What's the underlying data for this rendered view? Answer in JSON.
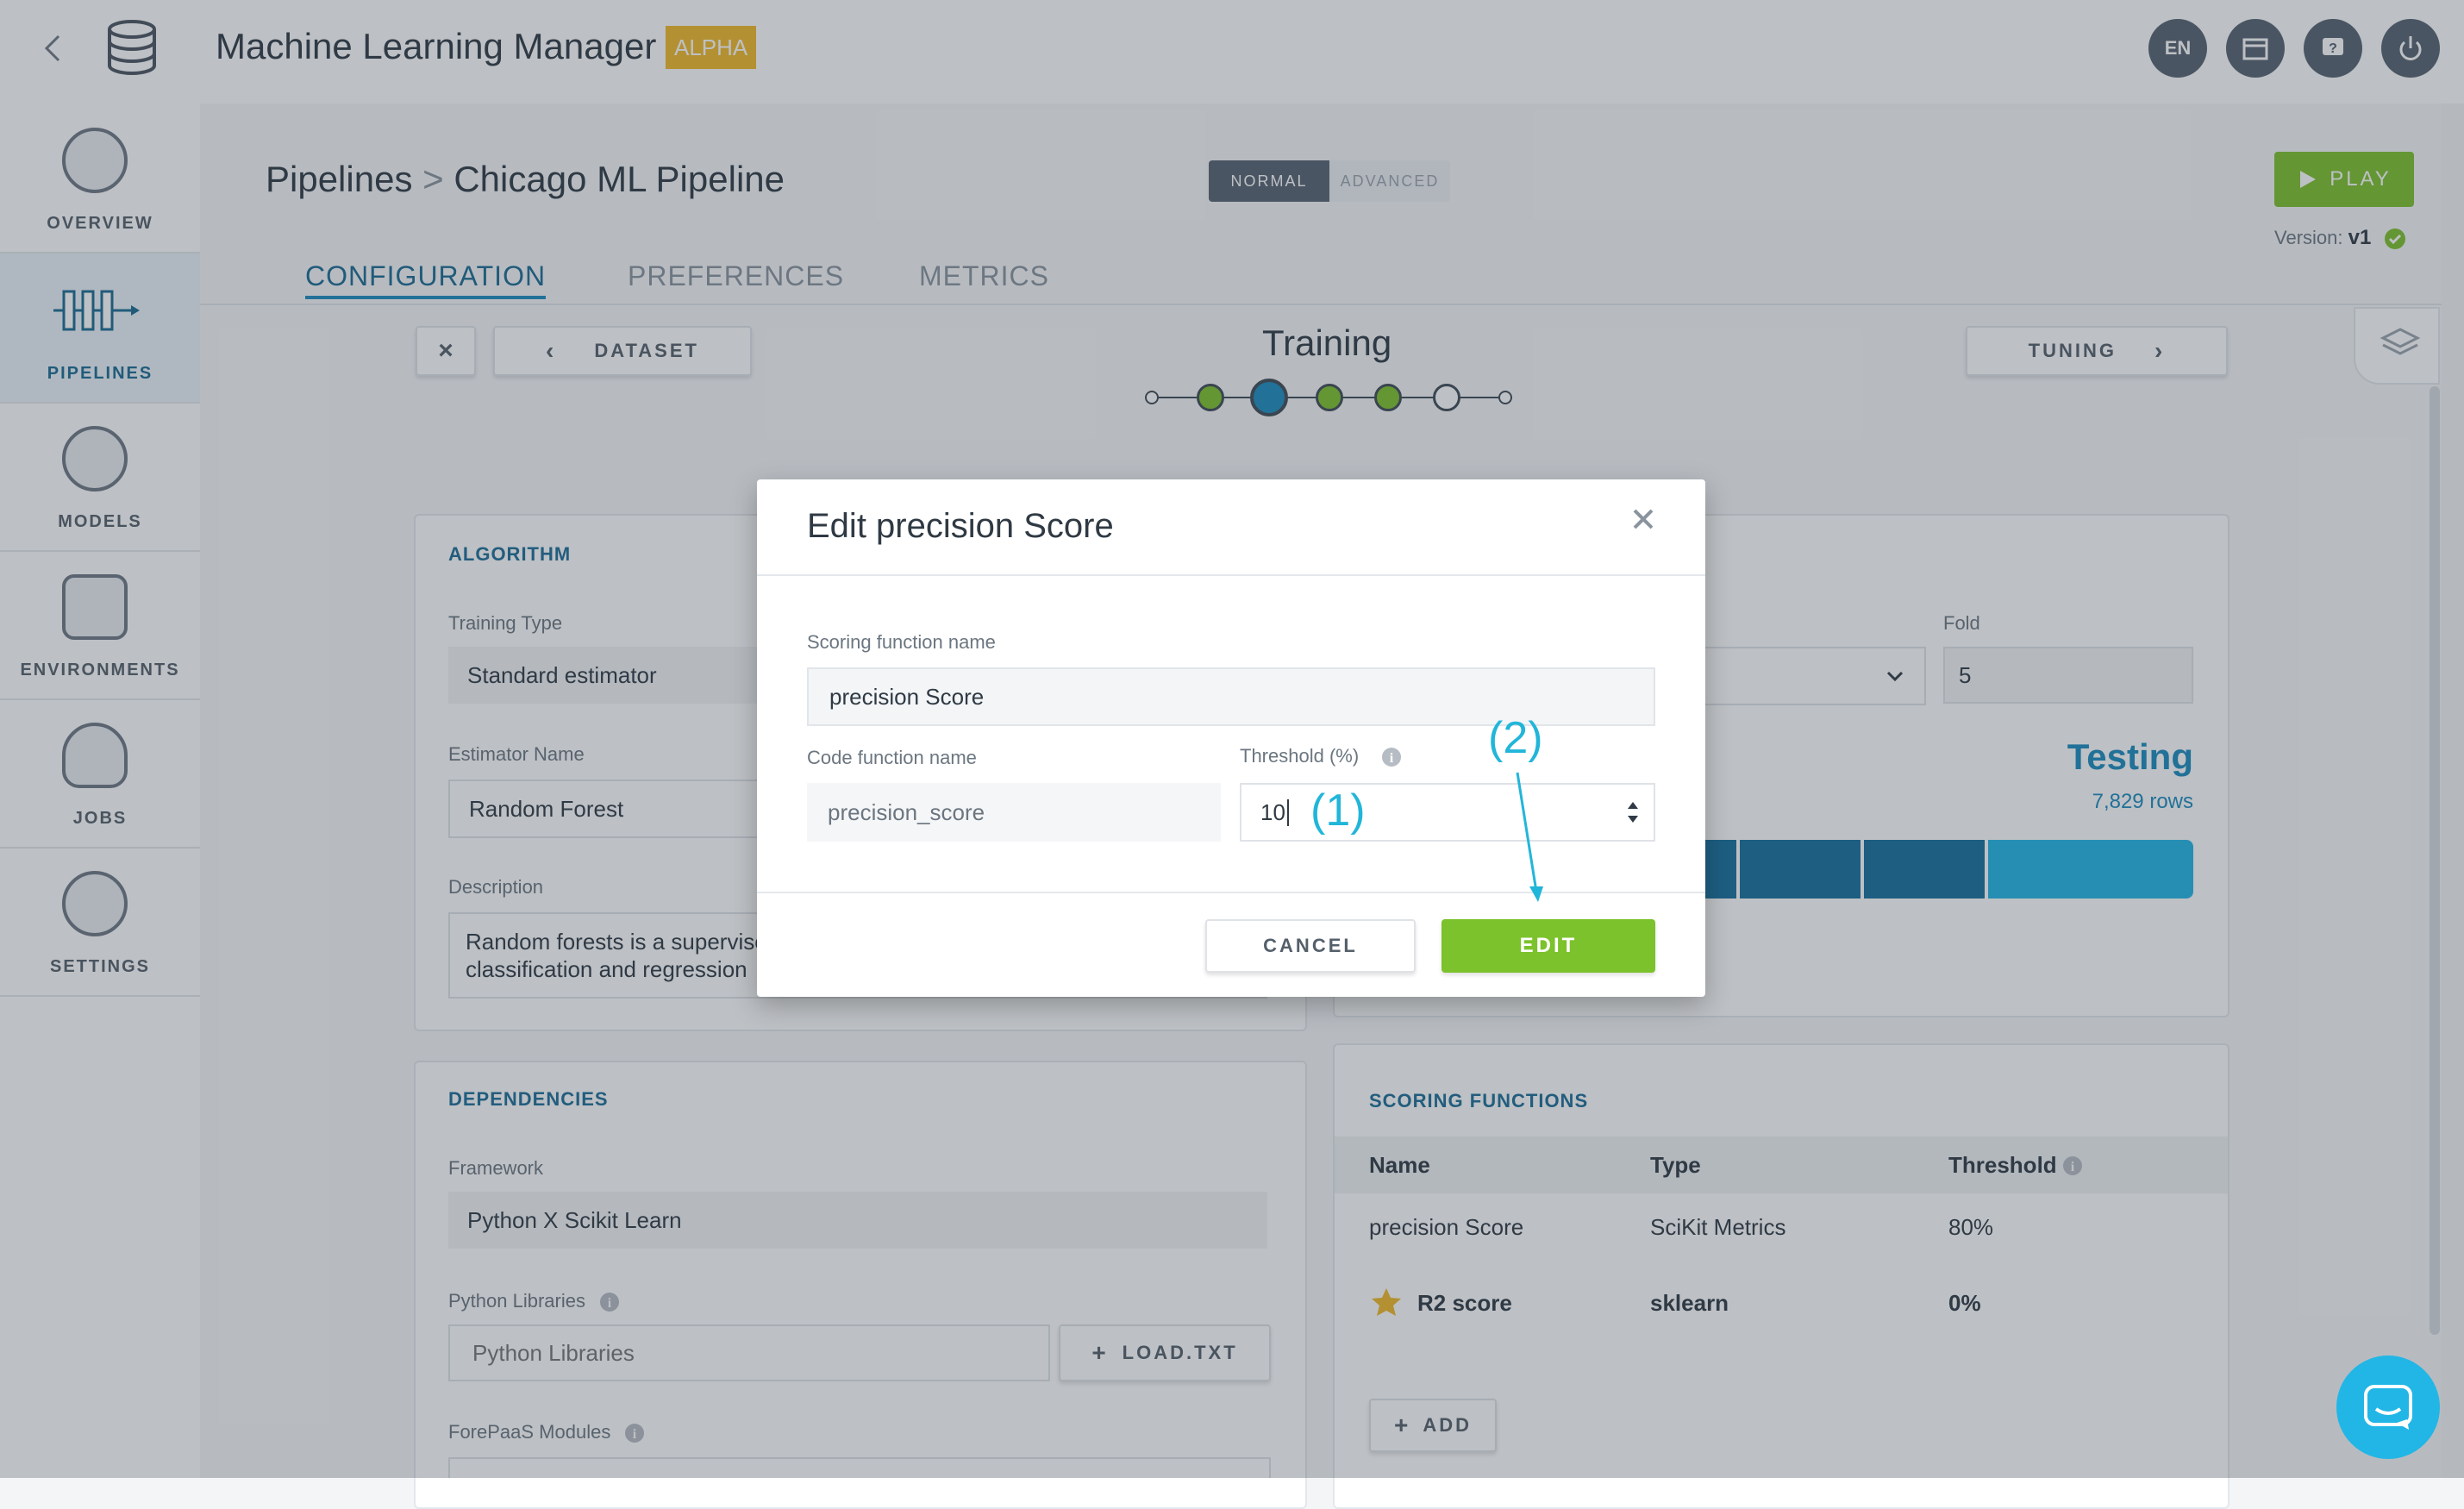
{
  "app": {
    "title": "Machine Learning Manager",
    "badge": "ALPHA",
    "lang": "EN"
  },
  "sidebar": {
    "items": [
      {
        "label": "OVERVIEW"
      },
      {
        "label": "PIPELINES"
      },
      {
        "label": "MODELS"
      },
      {
        "label": "ENVIRONMENTS"
      },
      {
        "label": "JOBS"
      },
      {
        "label": "SETTINGS"
      }
    ]
  },
  "header": {
    "breadcrumb_parent": "Pipelines",
    "breadcrumb_sep": ">",
    "breadcrumb_current": "Chicago ML Pipeline",
    "mode_normal": "NORMAL",
    "mode_advanced": "ADVANCED",
    "play_label": "PLAY",
    "version_label": "Version:",
    "version_value": "v1"
  },
  "tabs": [
    {
      "label": "CONFIGURATION"
    },
    {
      "label": "PREFERENCES"
    },
    {
      "label": "METRICS"
    }
  ],
  "stepper": {
    "prev_label": "DATASET",
    "title": "Training",
    "next_label": "TUNING"
  },
  "algorithm": {
    "title": "ALGORITHM",
    "training_type_label": "Training Type",
    "training_type_value": "Standard estimator",
    "estimator_label": "Estimator Name",
    "estimator_value": "Random Forest",
    "description_label": "Description",
    "description_line1": "Random forests is a supervise",
    "description_line2": "classification and regression"
  },
  "split": {
    "fold_label": "Fold",
    "fold_value": "5",
    "testing_label": "Testing",
    "testing_rows": "7,829 rows"
  },
  "dependencies": {
    "title": "DEPENDENCIES",
    "framework_label": "Framework",
    "framework_value": "Python X Scikit Learn",
    "libraries_label": "Python Libraries",
    "libraries_placeholder": "Python Libraries",
    "load_label": "LOAD.TXT",
    "modules_label": "ForePaaS Modules"
  },
  "scoring": {
    "title": "SCORING FUNCTIONS",
    "columns": [
      "Name",
      "Type",
      "Threshold"
    ],
    "rows": [
      {
        "name": "precision Score",
        "type": "SciKit Metrics",
        "threshold": "80%"
      },
      {
        "name": "R2 score",
        "type": "sklearn",
        "threshold": "0%"
      }
    ],
    "add_label": "ADD"
  },
  "modal": {
    "title": "Edit precision Score",
    "scoring_name_label": "Scoring function name",
    "scoring_name_value": "precision Score",
    "code_name_label": "Code function name",
    "code_name_value": "precision_score",
    "threshold_label": "Threshold (%)",
    "threshold_value": "10",
    "cancel_label": "CANCEL",
    "edit_label": "EDIT"
  },
  "annotations": {
    "one": "(1)",
    "two": "(2)"
  },
  "colors": {
    "accent": "#1a8bbf",
    "green": "#7cc22c",
    "badge": "#f0b928",
    "annotation": "#21b6d9"
  }
}
